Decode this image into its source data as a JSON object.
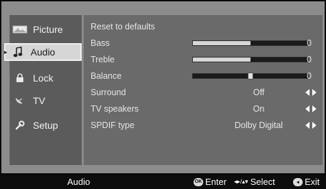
{
  "sidebar": {
    "items": [
      {
        "label": "Picture",
        "icon": "picture-icon"
      },
      {
        "label": "Audio",
        "icon": "music-note-icon"
      },
      {
        "label": "Lock",
        "icon": "lock-icon"
      },
      {
        "label": "TV",
        "icon": "satellite-dish-icon"
      },
      {
        "label": "Setup",
        "icon": "wrench-icon"
      }
    ],
    "active": "Audio"
  },
  "audio": {
    "reset": "Reset to defaults",
    "bass_label": "Bass",
    "bass_value": "0",
    "bass_level": 0.5,
    "treble_label": "Treble",
    "treble_value": "0",
    "treble_level": 0.5,
    "balance_label": "Balance",
    "balance_value": "0",
    "balance_position": 0.5,
    "surround_label": "Surround",
    "surround_value": "Off",
    "speakers_label": "TV speakers",
    "speakers_value": "On",
    "spdif_label": "SPDIF type",
    "spdif_value": "Dolby Digital"
  },
  "bottom": {
    "menu": "Audio",
    "enter": "Enter",
    "select": "Select",
    "exit": "Exit",
    "ok_badge": "OK",
    "arrows": "◂▸/▴▾"
  }
}
